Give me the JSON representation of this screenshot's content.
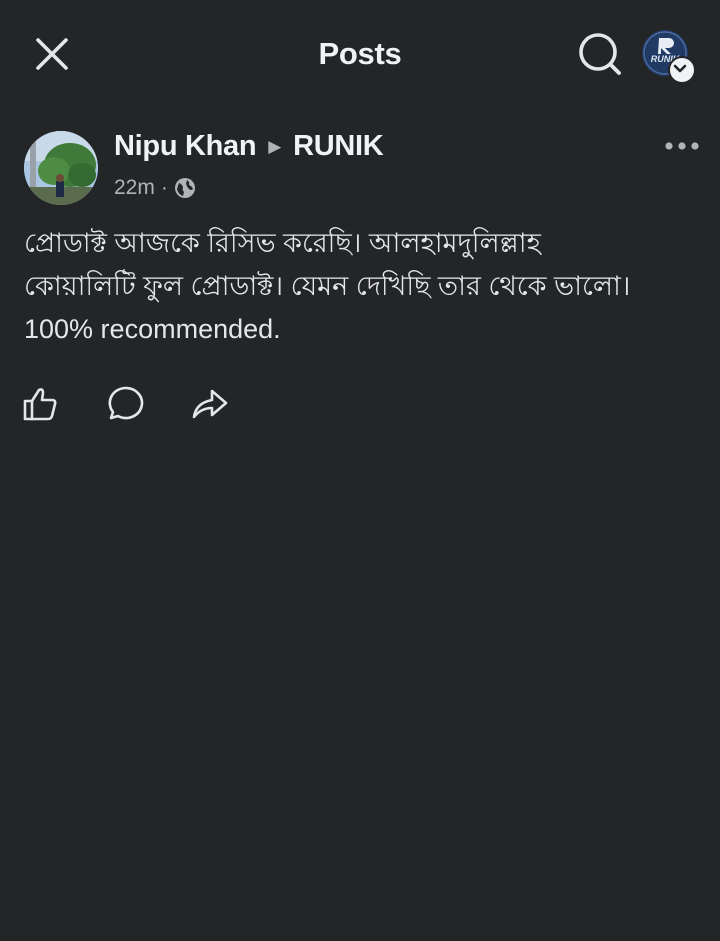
{
  "header": {
    "title": "Posts",
    "icons": {
      "close": "close-icon",
      "search": "search-icon",
      "profile": "profile-avatar",
      "profile_badge": "chevron-down-icon"
    },
    "profile_logo_text": "RUNIK"
  },
  "post": {
    "author": "Nipu Khan",
    "arrow": "▶",
    "group": "RUNIK",
    "time": "22m",
    "separator": "·",
    "privacy_icon": "globe-icon",
    "more_icon": "more-horizontal-icon",
    "text_lines": [
      "প্রোডাক্ট আজকে রিসিভ করেছি। আলহামদুলিল্লাহ",
      "কোয়ালিটি ফুল প্রোডাক্ট। যেমন দেখিছি তার থেকে ভালো।",
      "100% recommended."
    ],
    "actions": [
      {
        "name": "like",
        "icon": "thumbs-up-icon"
      },
      {
        "name": "comment",
        "icon": "comment-icon"
      },
      {
        "name": "share",
        "icon": "share-icon"
      }
    ]
  },
  "colors": {
    "background": "#242527",
    "text_primary": "#e4e6eb",
    "text_secondary": "#b0b3b8"
  }
}
